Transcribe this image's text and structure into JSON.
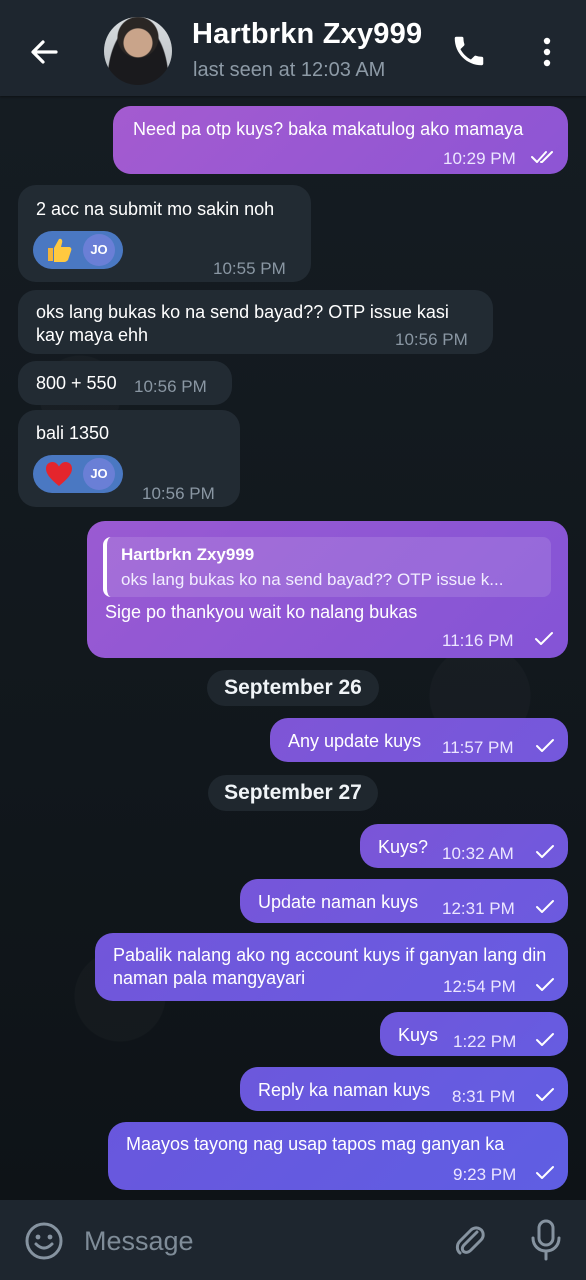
{
  "header": {
    "name": "Hartbrkn Zxy999",
    "status": "last seen at 12:03 AM"
  },
  "messages": [
    {
      "text": "Need pa otp kuys? baka makatulog ako mamaya",
      "time": "10:29 PM"
    },
    {
      "text": "2 acc na submit mo sakin noh",
      "time": "10:55 PM",
      "reaction": "JO"
    },
    {
      "text": "oks lang bukas ko na send bayad?? OTP issue kasi kay maya ehh",
      "time": "10:56 PM"
    },
    {
      "text": "800 + 550",
      "time": "10:56 PM"
    },
    {
      "text": "bali 1350",
      "time": "10:56 PM",
      "reaction": "JO"
    },
    {
      "reply_name": "Hartbrkn Zxy999",
      "reply_text": "oks lang bukas ko na send bayad?? OTP issue k...",
      "text": "Sige po thankyou wait ko nalang bukas",
      "time": "11:16 PM"
    },
    {
      "text": "Any update kuys",
      "time": "11:57 PM"
    },
    {
      "text": "Kuys?",
      "time": "10:32 AM"
    },
    {
      "text": "Update naman kuys",
      "time": "12:31 PM"
    },
    {
      "text": "Pabalik nalang ako ng account kuys if ganyan lang din naman pala mangyayari",
      "time": "12:54 PM"
    },
    {
      "text": "Kuys",
      "time": "1:22 PM"
    },
    {
      "text": "Reply ka naman kuys",
      "time": "8:31 PM"
    },
    {
      "text": "Maayos tayong nag usap tapos mag ganyan ka",
      "time": "9:23 PM"
    }
  ],
  "dates": {
    "sep26": "September 26",
    "sep27": "September 27"
  },
  "input": {
    "placeholder": "Message"
  },
  "colors": {
    "outgoing_bubble": "#7657d9",
    "incoming_bubble": "#222b33",
    "header": "#1e262f",
    "reaction": "#4a78c2"
  }
}
